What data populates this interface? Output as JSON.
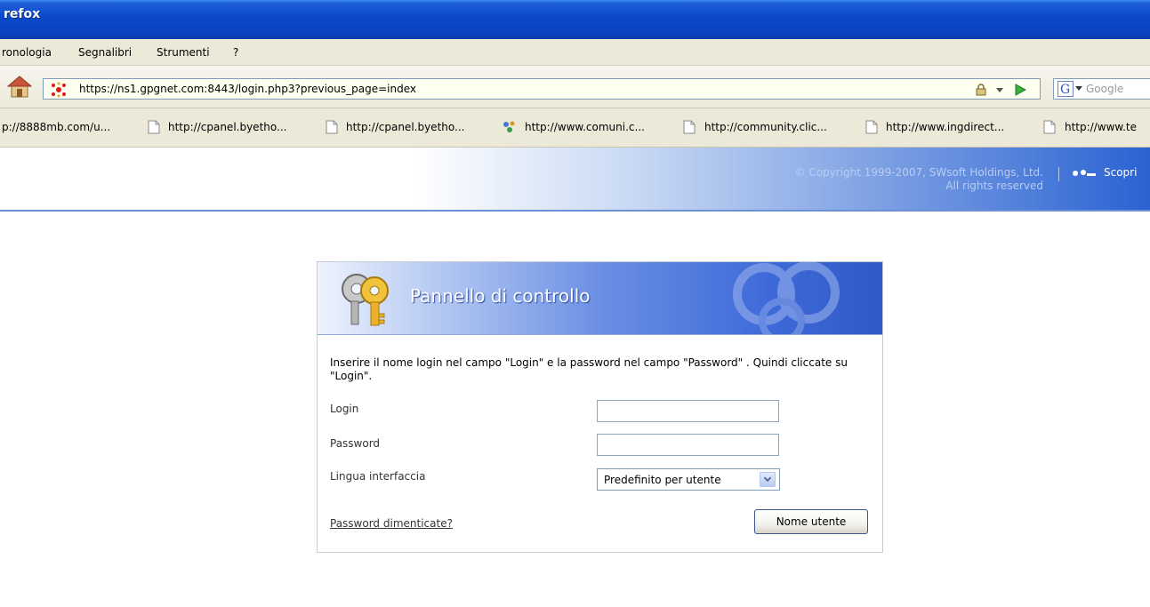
{
  "window": {
    "title": "refox"
  },
  "menu": {
    "items": [
      "ronologia",
      "Segnalibri",
      "Strumenti",
      "?"
    ]
  },
  "navbar": {
    "url": "https://ns1.gpgnet.com:8443/login.php3?previous_page=index",
    "search_placeholder": "Google"
  },
  "bookmarks": [
    "p://8888mb.com/u...",
    "http://cpanel.byetho...",
    "http://cpanel.byetho...",
    "http://www.comuni.c...",
    "http://community.clic...",
    "http://www.ingdirect...",
    "http://www.te"
  ],
  "header": {
    "copyright_line1": "© Copyright 1999-2007, SWsoft Holdings, Ltd.",
    "copyright_line2": "All rights reserved",
    "discover": "Scopri"
  },
  "panel": {
    "title": "Pannello di controllo",
    "intro": "Inserire il nome login nel campo \"Login\" e la password nel campo \"Password\" . Quindi cliccate su \"Login\".",
    "login_label": "Login",
    "password_label": "Password",
    "language_label": "Lingua interfaccia",
    "language_value": "Predefinito per utente",
    "forgot_link": "Password dimenticate?",
    "submit_label": "Nome utente"
  },
  "colors": {
    "titlebar": "#0a48c9",
    "chrome": "#ece9d8",
    "panel_header": "#3e6ad9",
    "header_band": "#2a62d2"
  }
}
